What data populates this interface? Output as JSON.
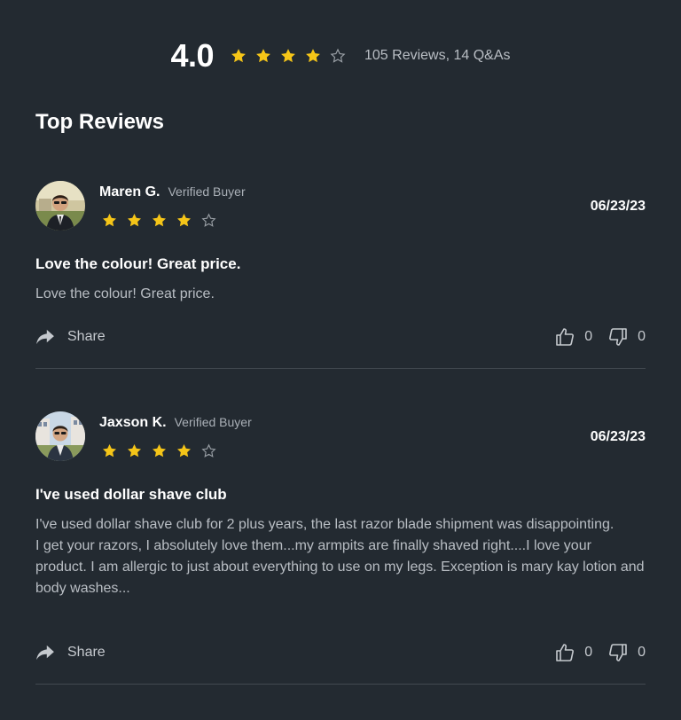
{
  "summary": {
    "rating": "4.0",
    "stars_filled": 4,
    "stars_total": 5,
    "count_text": "105 Reviews, 14 Q&As"
  },
  "section_title": "Top Reviews",
  "colors": {
    "background": "#232a31",
    "star_filled": "#f5c518",
    "star_empty": "#9aa0a6",
    "divider": "#424950",
    "muted_text": "#b9bec4"
  },
  "reviews": [
    {
      "name": "Maren G.",
      "badge": "Verified Buyer",
      "stars_filled": 4,
      "date": "06/23/23",
      "title": "Love the colour! Great price.",
      "body": [
        "Love the colour! Great price."
      ],
      "share_label": "Share",
      "helpful_count": "0",
      "unhelpful_count": "0"
    },
    {
      "name": "Jaxson K.",
      "badge": "Verified Buyer",
      "stars_filled": 4,
      "date": "06/23/23",
      "title": "I've used dollar shave club",
      "body": [
        "I've used dollar shave club for 2 plus years, the last razor blade shipment was disappointing.",
        "I get your razors, I absolutely love them...my armpits are finally shaved right....I love your product. I am allergic to just about everything to use on my legs. Exception is mary kay lotion and body washes..."
      ],
      "share_label": "Share",
      "helpful_count": "0",
      "unhelpful_count": "0"
    }
  ]
}
